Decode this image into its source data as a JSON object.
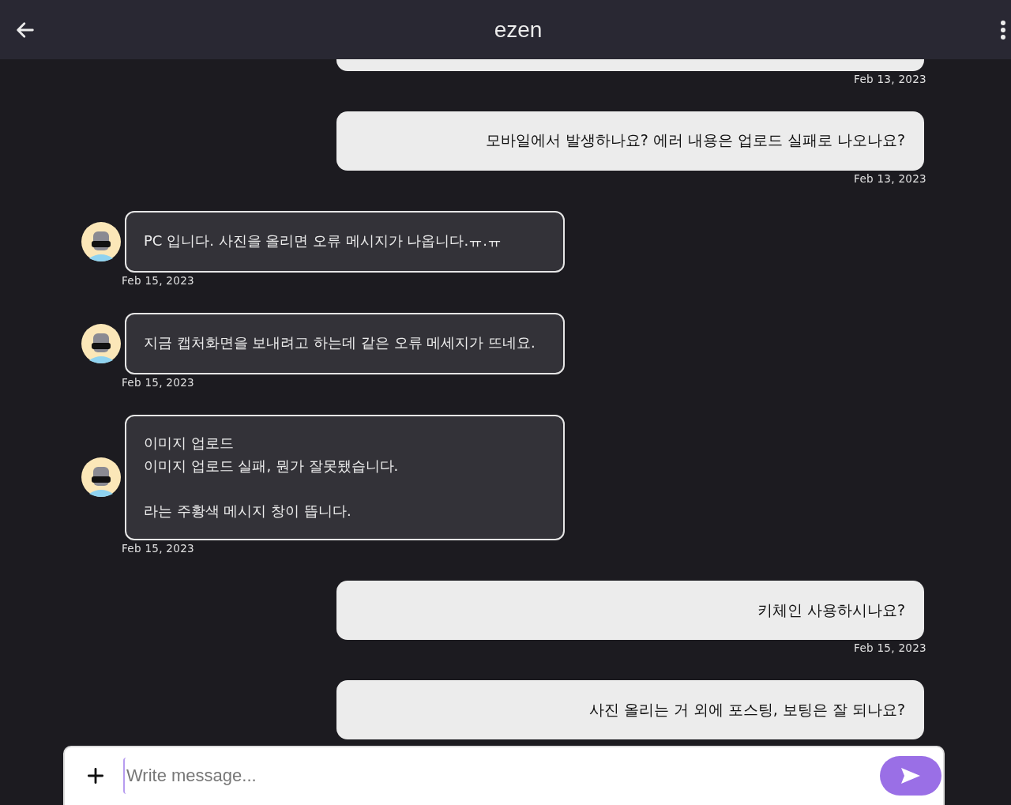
{
  "header": {
    "title": "ezen"
  },
  "messages": [
    {
      "kind": "sent",
      "date": "Feb 13, 2023"
    },
    {
      "kind": "sent",
      "text": "모바일에서 발생하나요? 에러 내용은 업로드 실패로 나오나요?",
      "date": "Feb 13, 2023"
    },
    {
      "kind": "received",
      "text": "PC 입니다. 사진을 올리면 오류 메시지가 나옵니다.ㅠ.ㅠ",
      "date": "Feb 15, 2023"
    },
    {
      "kind": "received",
      "text": "지금 캡처화면을 보내려고 하는데 같은 오류 메세지가 뜨네요.",
      "date": "Feb 15, 2023"
    },
    {
      "kind": "received",
      "text": "이미지 업로드\n이미지 업로드 실패, 뭔가 잘못됐습니다.\n\n라는 주황색 메시지 창이 뜹니다.",
      "date": "Feb 15, 2023"
    },
    {
      "kind": "sent",
      "text": "키체인 사용하시나요?",
      "date": "Feb 15, 2023"
    },
    {
      "kind": "sent",
      "text": "사진 올리는 거 외에 포스팅, 보팅은 잘 되나요?"
    }
  ],
  "composer": {
    "placeholder": "Write message..."
  }
}
